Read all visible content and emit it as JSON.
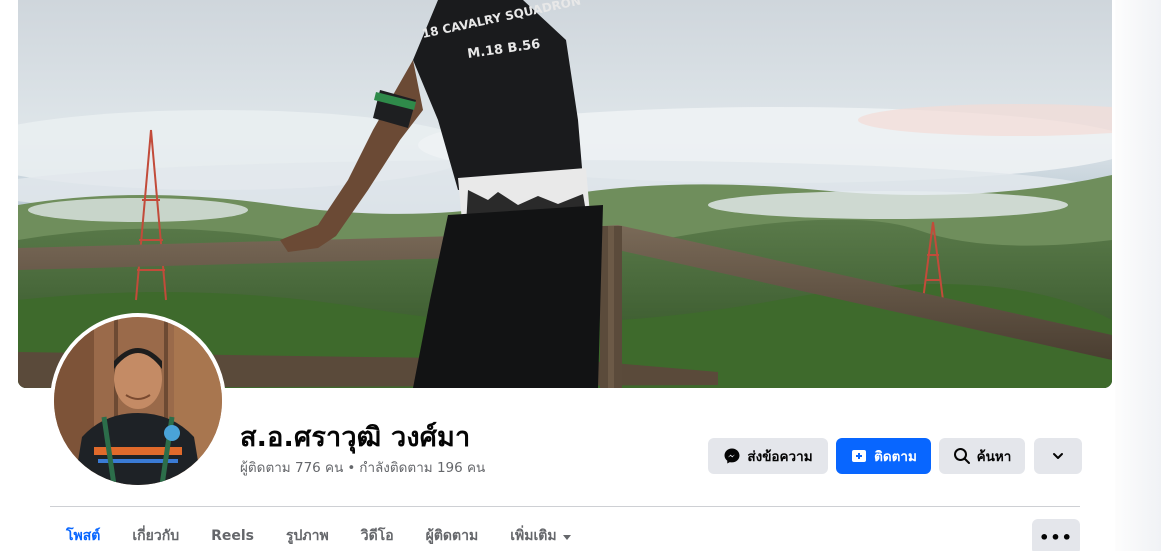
{
  "profile": {
    "name": "ส.อ.ศราวุฒิ วงศ์มา",
    "followers": "ผู้ติดตาม 776 คน",
    "separator": "•",
    "following": "กำลังติดตาม 196 คน"
  },
  "cover": {
    "shirt_text_line1": "18 CAVALRY SQUADRON",
    "shirt_text_line2": "M.18 B.56"
  },
  "actions": {
    "message_label": "ส่งข้อความ",
    "follow_label": "ติดตาม",
    "search_label": "ค้นหา"
  },
  "tabs": [
    {
      "label": "โพสต์",
      "active": true
    },
    {
      "label": "เกี่ยวกับ",
      "active": false
    },
    {
      "label": "Reels",
      "active": false
    },
    {
      "label": "รูปภาพ",
      "active": false
    },
    {
      "label": "วิดีโอ",
      "active": false
    },
    {
      "label": "ผู้ติดตาม",
      "active": false
    },
    {
      "label": "เพิ่มเติม",
      "active": false
    }
  ],
  "icons": {
    "message": "messenger-icon",
    "follow": "follow-plus-icon",
    "search": "search-icon",
    "dropdown": "chevron-down-icon",
    "more": "more-dots-icon"
  },
  "colors": {
    "accent": "#0866ff",
    "button_gray": "#e4e6eb",
    "text_primary": "#050505",
    "text_secondary": "#65676b"
  },
  "more_dots": "•••"
}
